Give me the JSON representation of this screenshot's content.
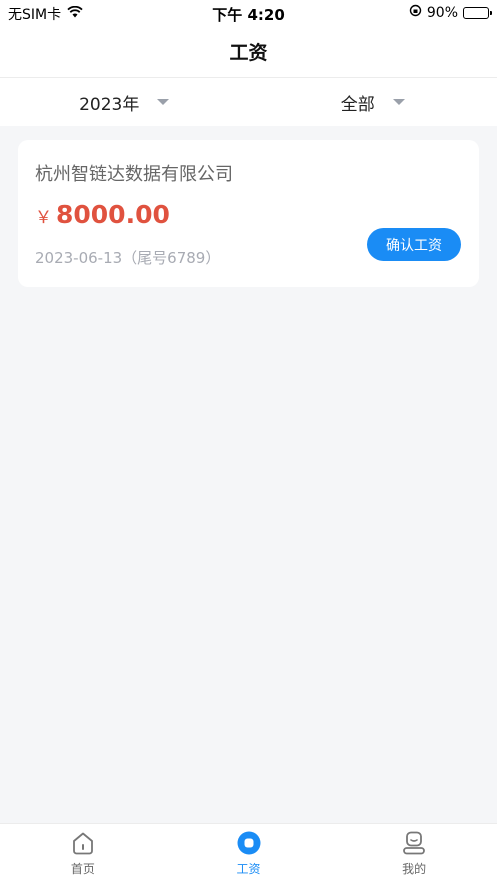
{
  "status_bar": {
    "carrier": "无SIM卡",
    "time": "下午 4:20",
    "battery_text": "90%",
    "battery_level": 0.9
  },
  "nav": {
    "title": "工资"
  },
  "filters": {
    "year": "2023年",
    "category": "全部"
  },
  "salary_card": {
    "company": "杭州智链达数据有限公司",
    "currency_symbol": "￥",
    "amount": "8000.00",
    "meta": "2023-06-13（尾号6789）",
    "confirm_label": "确认工资"
  },
  "tabbar": {
    "tabs": [
      {
        "label": "首页",
        "icon": "home-icon",
        "active": false
      },
      {
        "label": "工资",
        "icon": "salary-icon",
        "active": true
      },
      {
        "label": "我的",
        "icon": "profile-icon",
        "active": false
      }
    ]
  },
  "colors": {
    "accent": "#1a8cf5",
    "amount": "#e0523f",
    "background": "#f5f6f8"
  }
}
